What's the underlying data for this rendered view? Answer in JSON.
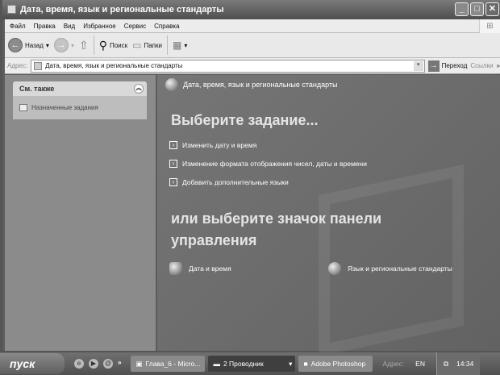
{
  "window": {
    "title": "Дата, время, язык и региональные стандарты",
    "minimize": "_",
    "maximize": "□",
    "close": "✕"
  },
  "menu": [
    "Файл",
    "Правка",
    "Вид",
    "Избранное",
    "Сервис",
    "Справка"
  ],
  "toolbar": {
    "back": "Назад",
    "search": "Поиск",
    "folders": "Папки"
  },
  "address": {
    "label": "Адрес:",
    "value": "Дата, время, язык и региональные стандарты",
    "go": "Переход",
    "links": "Ссылки",
    "more": "»"
  },
  "sidebar": {
    "see_also": "См. также",
    "items": [
      "Назначенные задания"
    ]
  },
  "main": {
    "header": "Дата, время, язык и региональные стандарты",
    "pick_task": "Выберите задание...",
    "tasks": [
      "Изменить дату и время",
      "Изменение формата отображения чисел, даты и времени",
      "Добавить дополнительные языки"
    ],
    "or_pick": "или выберите значок панели управления",
    "icons": [
      "Дата и время",
      "Язык и региональные стандарты"
    ]
  },
  "taskbar": {
    "start": "пуск",
    "more": "»",
    "buttons": [
      "Глава_6 - Micro...",
      "2 Проводник",
      "Adobe Photoshop"
    ],
    "address": "Адрес:",
    "lang": "EN",
    "clock": "14:34"
  }
}
